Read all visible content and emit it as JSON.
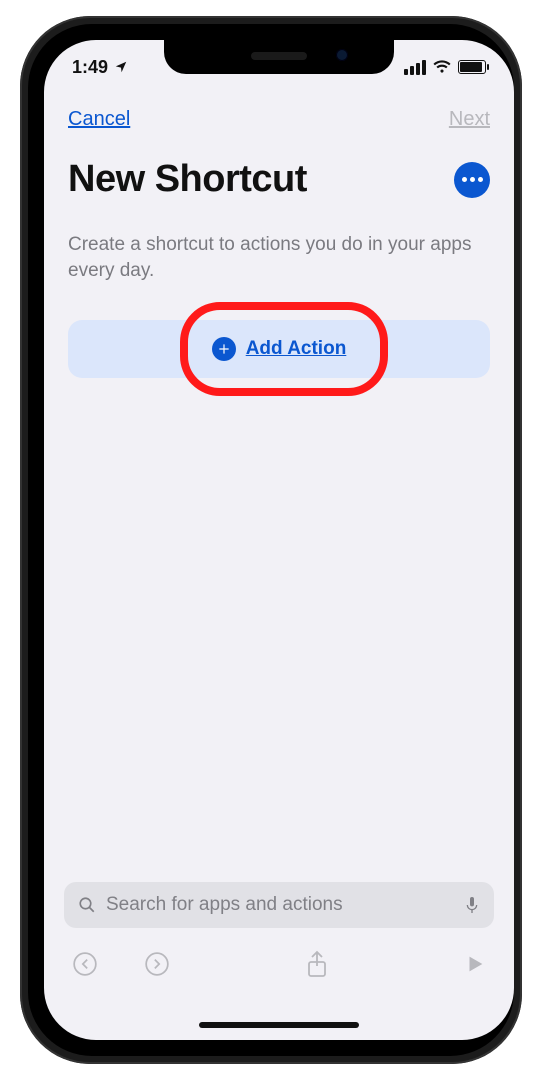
{
  "status": {
    "time": "1:49",
    "location_icon": "location-arrow",
    "signal_bars": 4,
    "wifi": true,
    "battery_pct": 95
  },
  "nav": {
    "cancel_label": "Cancel",
    "next_label": "Next"
  },
  "header": {
    "title": "New Shortcut",
    "more_icon": "ellipsis"
  },
  "subtitle": "Create a shortcut to actions you do in your apps every day.",
  "add_action": {
    "label": "Add Action",
    "icon": "plus"
  },
  "search": {
    "placeholder": "Search for apps and actions",
    "leading_icon": "magnifying-glass",
    "trailing_icon": "mic"
  },
  "toolbar": {
    "undo_icon": "undo",
    "redo_icon": "redo",
    "share_icon": "share",
    "run_icon": "play"
  },
  "annotation": {
    "highlight_target": "add-action-button"
  }
}
